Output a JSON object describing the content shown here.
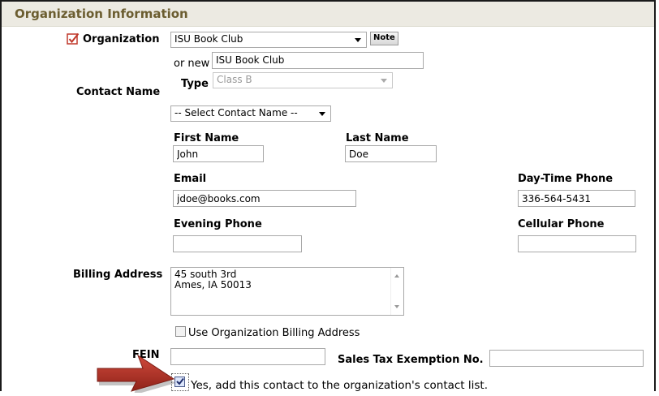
{
  "section": {
    "title": "Organization Information"
  },
  "organization": {
    "label": "Organization",
    "selected": "ISU Book Club",
    "note_button": "Note",
    "or_new_label": "or new",
    "new_value": "ISU Book Club",
    "type_label": "Type",
    "type_value": "Class B"
  },
  "contact": {
    "label": "Contact Name",
    "select_placeholder": "-- Select Contact Name --",
    "first_name_label": "First Name",
    "first_name": "John",
    "last_name_label": "Last Name",
    "last_name": "Doe",
    "email_label": "Email",
    "email": "jdoe@books.com",
    "day_phone_label": "Day-Time Phone",
    "day_phone": "336-564-5431",
    "evening_phone_label": "Evening Phone",
    "evening_phone": "",
    "cell_phone_label": "Cellular Phone",
    "cell_phone": ""
  },
  "billing": {
    "label": "Billing Address",
    "line1": "45 south 3rd",
    "line2": "Ames, IA  50013",
    "use_org_label": "Use Organization Billing Address",
    "use_org_checked": false
  },
  "tax": {
    "fein_label": "FEIN",
    "fein": "",
    "exemption_label": "Sales Tax Exemption No.",
    "exemption": ""
  },
  "add_contact": {
    "label": "Yes, add this contact to the organization's contact list.",
    "checked": true
  },
  "colors": {
    "header_bg": "#eceae2",
    "header_text": "#6b5d30",
    "required_check": "#c0392b",
    "arrow": "#b03428"
  },
  "icons": {
    "required": "red-checkbox-icon",
    "annotation": "pointer-arrow-icon"
  }
}
